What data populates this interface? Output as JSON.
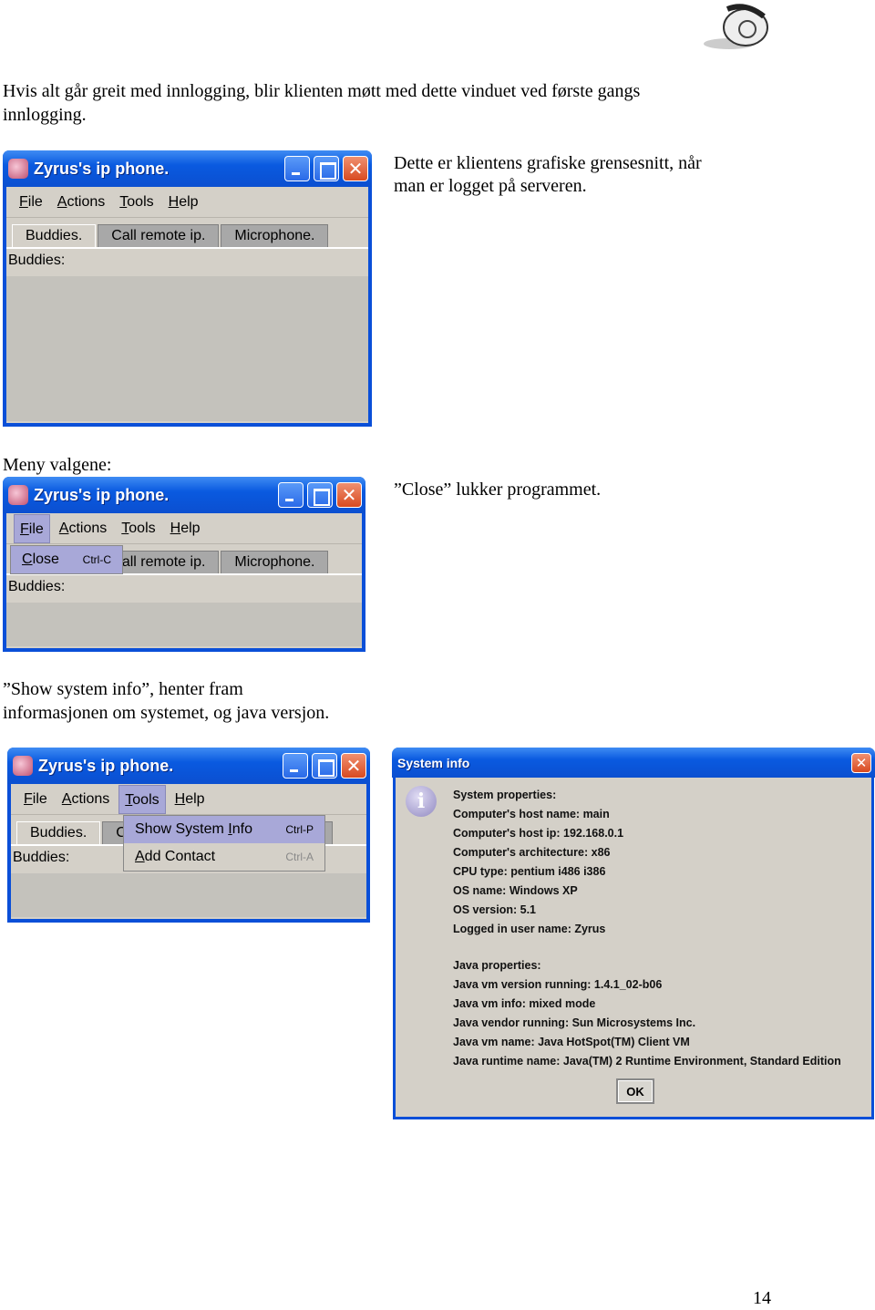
{
  "logo": "phone-logo",
  "intro": [
    "Hvis alt går greit med innlogging, blir klienten møtt med dette vinduet ved første gangs",
    "innlogging."
  ],
  "desc1": [
    "Dette er klientens grafiske grensesnitt, når",
    "man er logget på serveren."
  ],
  "meny_label": "Meny valgene:",
  "close_desc": "”Close” lukker programmet.",
  "sysinfo_desc": [
    "”Show system info”, henter fram",
    "informasjonen om systemet, og java versjon."
  ],
  "app": {
    "title": "Zyrus's ip phone.",
    "menu": [
      {
        "u": "F",
        "r": "ile"
      },
      {
        "u": "A",
        "r": "ctions"
      },
      {
        "u": "T",
        "r": "ools"
      },
      {
        "u": "H",
        "r": "elp"
      }
    ],
    "tabs": [
      "Buddies.",
      "Call remote ip.",
      "Microphone."
    ],
    "buddies_label": "Buddies:"
  },
  "file_menu": {
    "close_u": "C",
    "close_r": "lose",
    "close_sc": "Ctrl-C"
  },
  "tools_menu": {
    "show_a": "Show System ",
    "show_u": "I",
    "show_b": "nfo",
    "show_sc": "Ctrl-P",
    "add_u": "A",
    "add_r": "dd Contact",
    "add_sc": "Ctrl-A"
  },
  "dialog": {
    "title": "System info",
    "lines": [
      "System properties:",
      "Computer's host name:  main",
      "Computer's host ip:  192.168.0.1",
      "Computer's architecture:  x86",
      "CPU type:  pentium i486 i386",
      "OS name:  Windows XP",
      "OS version:  5.1",
      "Logged in user name:  Zyrus"
    ],
    "java_lines": [
      "Java properties:",
      "Java vm version running:  1.4.1_02-b06",
      "Java vm info:  mixed mode",
      "Java vendor running:  Sun Microsystems Inc.",
      "Java vm name:  Java HotSpot(TM) Client VM",
      "Java runtime name:  Java(TM) 2 Runtime Environment, Standard Edition"
    ],
    "ok": "OK"
  },
  "page_number": "14",
  "colors": {
    "titlebar": "#0a4fd8",
    "window_bg": "#d4d0c8",
    "menu_highlight": "#a8a8d8"
  }
}
